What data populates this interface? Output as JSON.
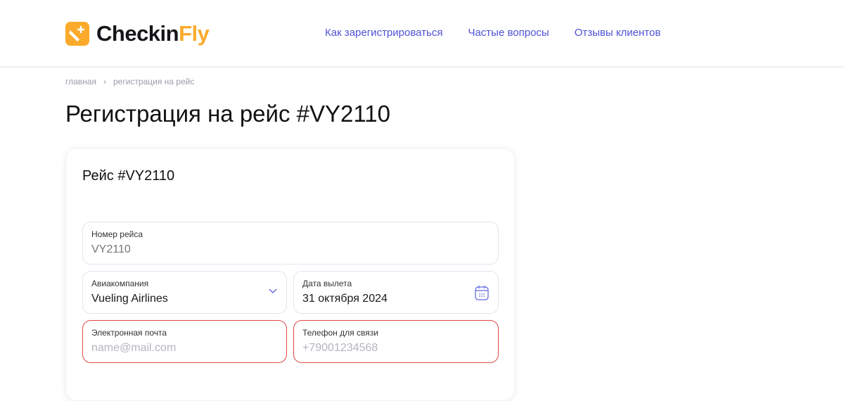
{
  "header": {
    "logo_part1": "Checkin",
    "logo_part2": "Fly",
    "nav": [
      "Как зарегистрироваться",
      "Частые вопросы",
      "Отзывы клиентов"
    ]
  },
  "breadcrumb": {
    "home": "главная",
    "sep": "›",
    "current": "регистрация на рейс"
  },
  "page_title": "Регистрация на рейс #VY2110",
  "card": {
    "title": "Рейс #VY2110",
    "flight_number": {
      "label": "Номер рейса",
      "value": "VY2110"
    },
    "airline": {
      "label": "Авиакомпания",
      "value": "Vueling Airlines"
    },
    "date": {
      "label": "Дата вылета",
      "value": "31 октября 2024"
    },
    "email": {
      "label": "Электронная почта",
      "placeholder": "name@mail.com"
    },
    "phone": {
      "label": "Телефон для связи",
      "placeholder": "+79001234568"
    }
  },
  "colors": {
    "brand": "#FBAA2B",
    "link": "#4f52d6",
    "error": "#e04848"
  }
}
